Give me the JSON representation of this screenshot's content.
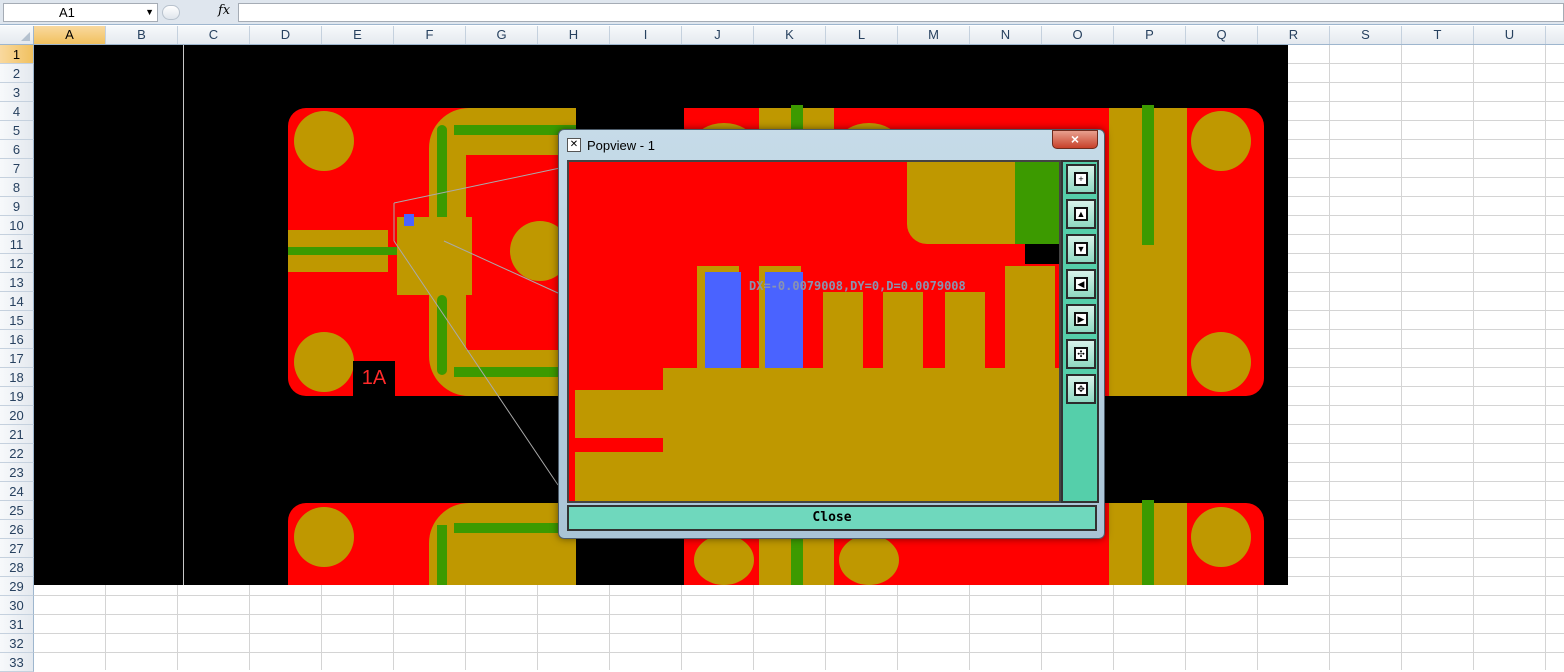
{
  "formula_bar": {
    "name_box": "A1",
    "fx_label": "fx",
    "formula": ""
  },
  "columns": [
    "A",
    "B",
    "C",
    "D",
    "E",
    "F",
    "G",
    "H",
    "I",
    "J",
    "K",
    "L",
    "M",
    "N",
    "O",
    "P",
    "Q",
    "R",
    "S",
    "T",
    "U"
  ],
  "rows": [
    "1",
    "2",
    "3",
    "4",
    "5",
    "6",
    "7",
    "8",
    "9",
    "10",
    "11",
    "12",
    "13",
    "14",
    "15",
    "16",
    "17",
    "18",
    "19",
    "20",
    "21",
    "22",
    "23",
    "24",
    "25",
    "26",
    "27",
    "28",
    "29",
    "30",
    "31",
    "32",
    "33"
  ],
  "selected_cell": {
    "column": "A",
    "row": "1"
  },
  "pcb": {
    "silk_label": "1A",
    "colors": {
      "copper": "#ff0000",
      "pad": "#bf9800",
      "trace": "#3c9a00",
      "via": "#4a63ff",
      "board": "#000000"
    }
  },
  "popview": {
    "title": "Popview - 1",
    "close_x": "×",
    "measurement": "DX=-0.0079008,DY=0,D=0.0079008",
    "close_button": "Close",
    "toolbar": [
      "zoom-in-icon",
      "pan-up-icon",
      "pan-down-icon",
      "pan-left-icon",
      "pan-right-icon",
      "fit-view-icon",
      "center-view-icon"
    ]
  }
}
